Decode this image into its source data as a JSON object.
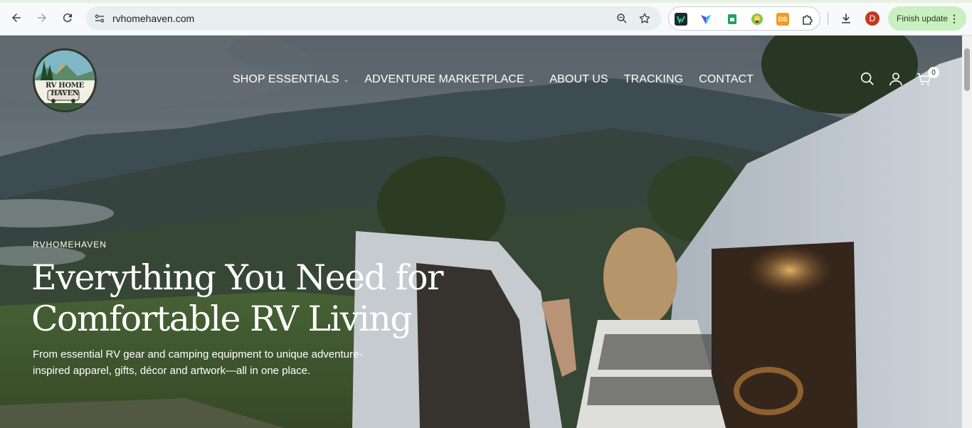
{
  "browser": {
    "url": "rvhomehaven.com",
    "avatar_letter": "D",
    "finish_update_label": "Finish update",
    "menu_glyph": "⋮",
    "extensions": [
      "vidiq-extension-icon",
      "shield-extension-icon",
      "sheets-extension-icon",
      "bulb-extension-icon",
      "ds-extension-icon",
      "puzzle-extensions-icon"
    ],
    "ds_ext_label": "DS"
  },
  "site": {
    "logo_text": "RV HOME HAVEN",
    "nav": [
      {
        "label": "SHOP ESSENTIALS",
        "has_dropdown": true
      },
      {
        "label": "ADVENTURE MARKETPLACE",
        "has_dropdown": true
      },
      {
        "label": "ABOUT US",
        "has_dropdown": false
      },
      {
        "label": "TRACKING",
        "has_dropdown": false
      },
      {
        "label": "CONTACT",
        "has_dropdown": false
      }
    ],
    "cart_count": "0"
  },
  "hero": {
    "eyebrow": "RVHOMEHAVEN",
    "headline_line1": "Everything You Need for",
    "headline_line2": "Comfortable RV Living",
    "subhead": "From essential RV gear and camping equipment to unique adventure-inspired apparel, gifts, décor and artwork—all in one place."
  },
  "colors": {
    "accent_update": "#c8f0c0",
    "avatar_bg": "#c5381d"
  }
}
